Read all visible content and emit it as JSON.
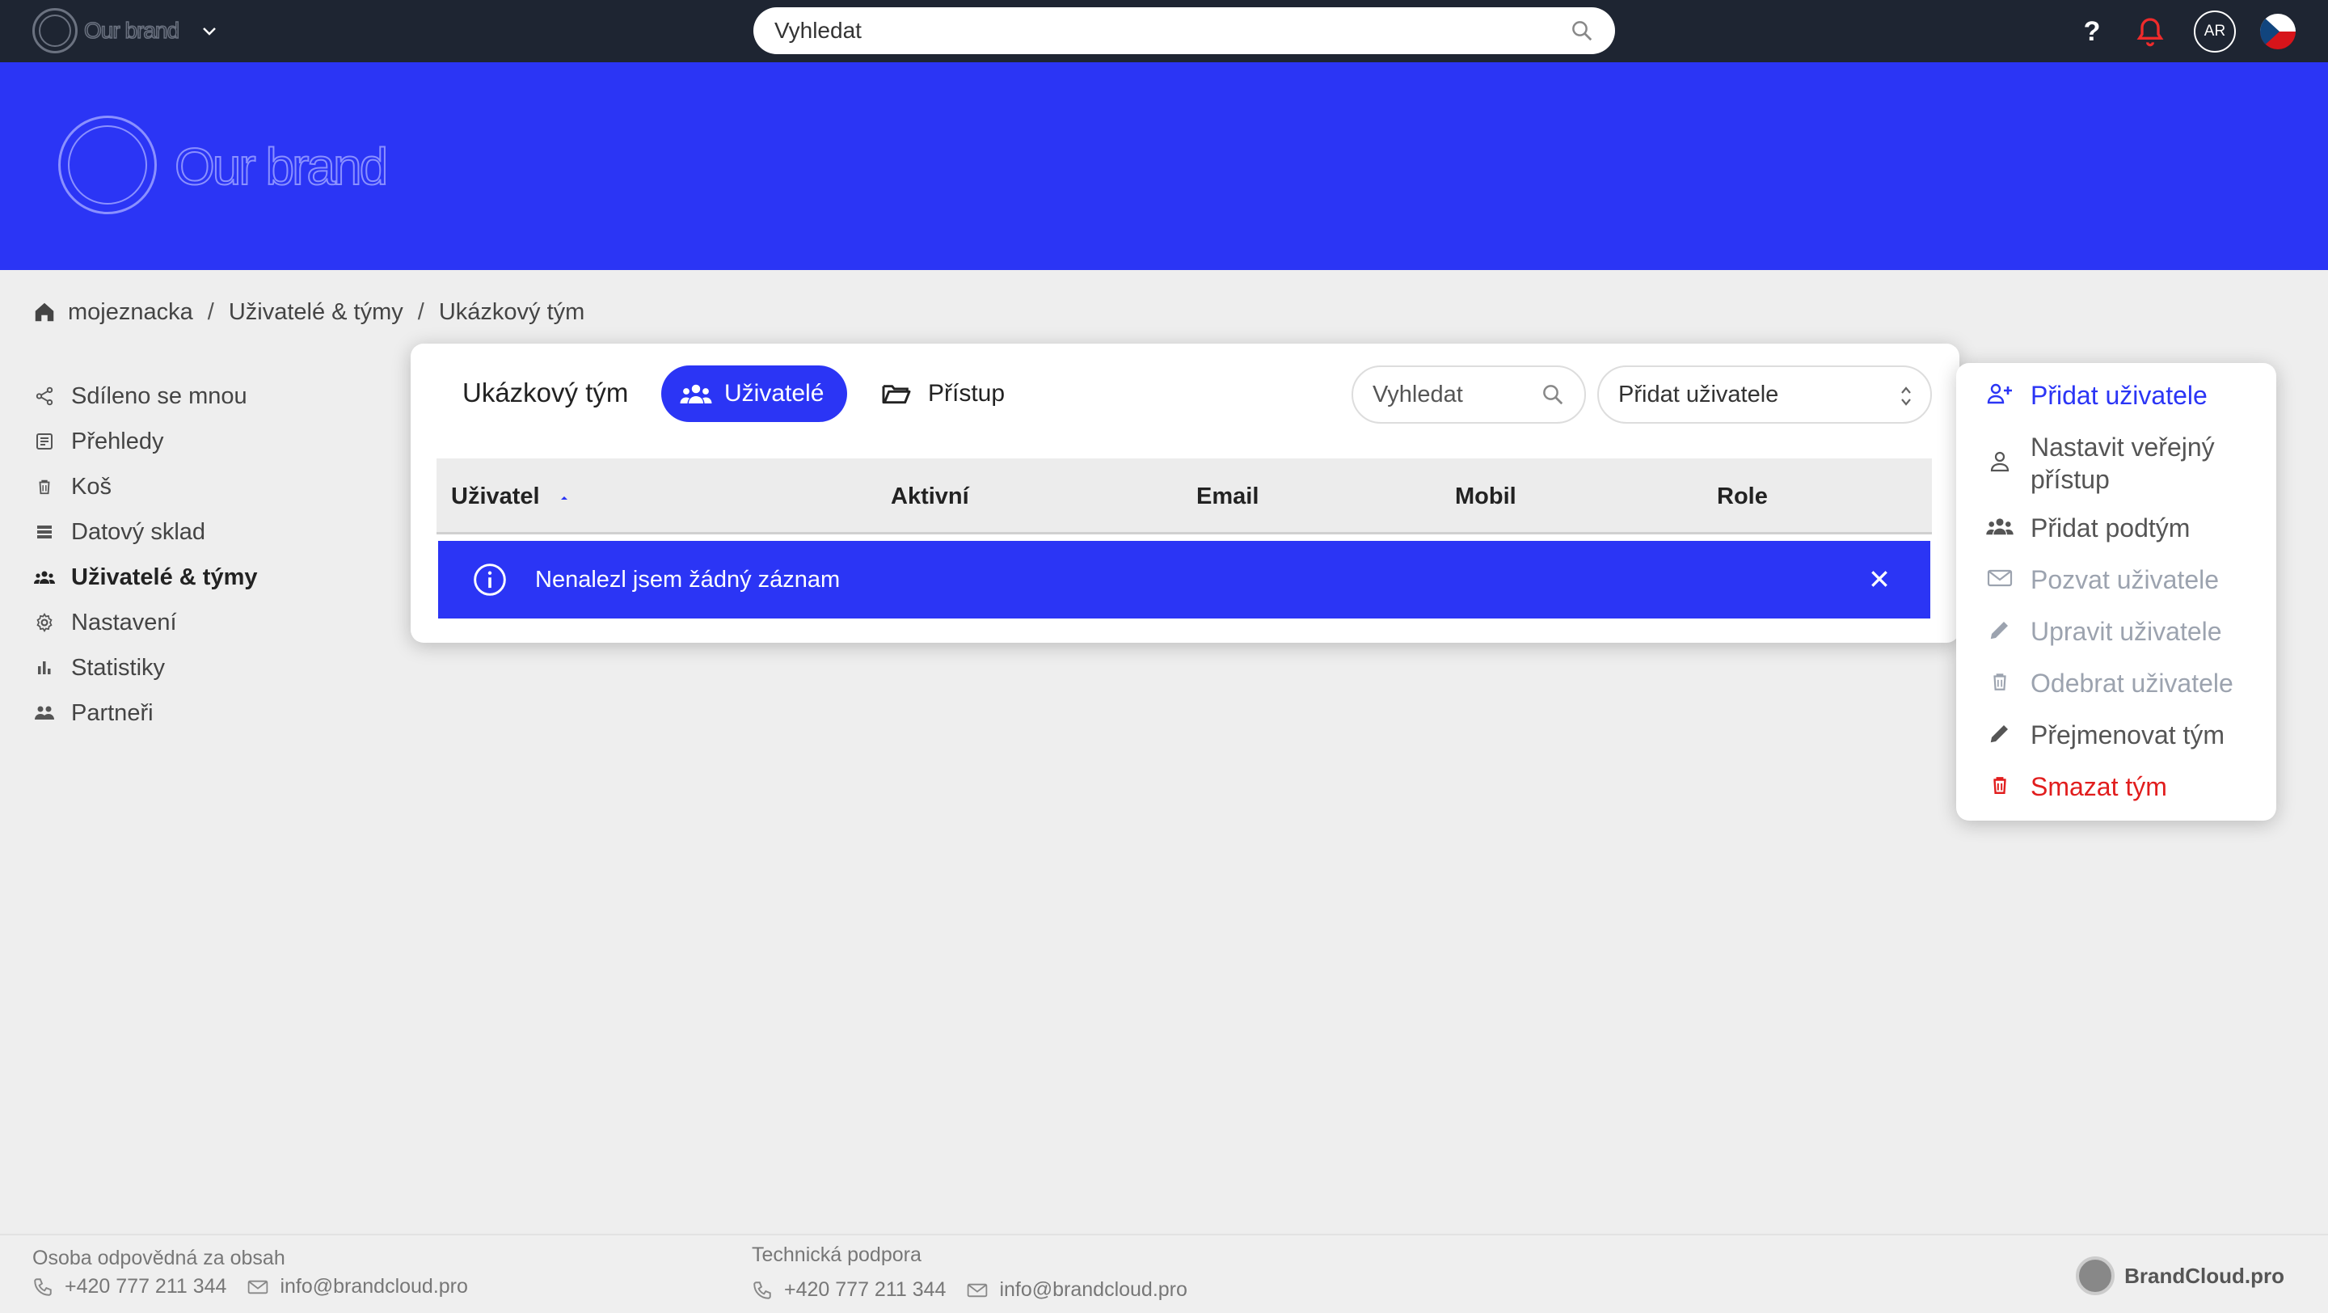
{
  "topbar": {
    "brand": "Our brand",
    "search_placeholder": "Vyhledat",
    "help_label": "?",
    "avatar_initials": "AR"
  },
  "banner": {
    "brand": "Our brand"
  },
  "breadcrumb": {
    "items": [
      "mojeznacka",
      "Uživatelé & týmy",
      "Ukázkový tým"
    ],
    "separator": "/"
  },
  "sidebar": {
    "items": [
      {
        "label": "Sdíleno se mnou",
        "icon": "share-icon"
      },
      {
        "label": "Přehledy",
        "icon": "report-icon"
      },
      {
        "label": "Koš",
        "icon": "trash-icon"
      },
      {
        "label": "Datový sklad",
        "icon": "list-icon"
      },
      {
        "label": "Uživatelé & týmy",
        "icon": "people-icon",
        "active": true
      },
      {
        "label": "Nastavení",
        "icon": "gear-icon"
      },
      {
        "label": "Statistiky",
        "icon": "bar-chart-icon"
      },
      {
        "label": "Partneři",
        "icon": "partners-icon"
      }
    ]
  },
  "card": {
    "title": "Ukázkový tým",
    "tab_users": "Uživatelé",
    "tab_access": "Přístup",
    "search_placeholder": "Vyhledat",
    "select_value": "Přidat uživatele",
    "columns": [
      "Uživatel",
      "Aktivní",
      "Email",
      "Mobil",
      "Role"
    ],
    "empty_message": "Nenalezl jsem žádný záznam"
  },
  "menu": {
    "items": [
      {
        "label": "Přidat uživatele",
        "state": "primary"
      },
      {
        "label": "Nastavit veřejný přístup",
        "state": "normal"
      },
      {
        "label": "Přidat podtým",
        "state": "normal"
      },
      {
        "label": "Pozvat uživatele",
        "state": "disabled"
      },
      {
        "label": "Upravit uživatele",
        "state": "disabled"
      },
      {
        "label": "Odebrat uživatele",
        "state": "disabled"
      },
      {
        "label": "Přejmenovat tým",
        "state": "normal"
      },
      {
        "label": "Smazat tým",
        "state": "danger"
      }
    ]
  },
  "footer": {
    "content_title": "Osoba odpovědná za obsah",
    "content_phone": "+420 777 211 344",
    "content_email": "info@brandcloud.pro",
    "support_title": "Technická podpora",
    "support_phone": "+420 777 211 344",
    "support_email": "info@brandcloud.pro",
    "brand": "BrandCloud.pro"
  },
  "colors": {
    "accent": "#2b35f5",
    "topbar": "#1e2532",
    "danger": "#e11d1d",
    "disabled": "#9ca3af"
  }
}
